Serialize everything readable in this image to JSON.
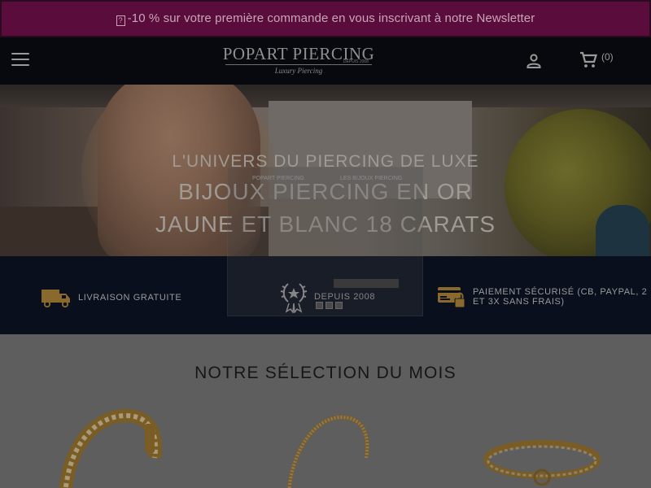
{
  "promo": {
    "icon": "info-icon",
    "text": "-10 % sur votre première commande en vous inscrivant à notre Newsletter"
  },
  "header": {
    "logo_main": "POPART PIERCING",
    "logo_since": "DEPUIS 2008",
    "logo_sub": "Luxury Piercing",
    "cart_count": "(0)"
  },
  "hero": {
    "kicker": "L'UNIVERS DU PIERCING DE LUXE",
    "title_line1": "BIJOUX PIERCING EN OR",
    "title_line2": "JAUNE ET BLANC 18 CARATS"
  },
  "popup": {
    "label_left": "POPART PIERCING",
    "label_right": "LES BIJOUX PIERCING"
  },
  "reassurance": [
    {
      "icon": "truck-icon",
      "label": "LIVRAISON GRATUITE"
    },
    {
      "icon": "laurel-award-icon",
      "label": "DEPUIS 2008"
    },
    {
      "icon": "secure-payment-icon",
      "label": "PAIEMENT SÉCURISÉ (CB, PAYPAL, 2 ET 3X SANS FRAIS)"
    }
  ],
  "selection": {
    "title": "NOTRE SÉLECTION DU MOIS",
    "products": [
      {
        "icon": "gold-ring-gems-icon"
      },
      {
        "icon": "gold-beaded-ring-icon"
      },
      {
        "icon": "gold-eternity-ring-icon"
      }
    ]
  },
  "colors": {
    "promo_bg": "#5a0d3c",
    "header_bg": "#08090e",
    "band_bg": "#0a0f1e",
    "gold": "#8a6a2c"
  }
}
